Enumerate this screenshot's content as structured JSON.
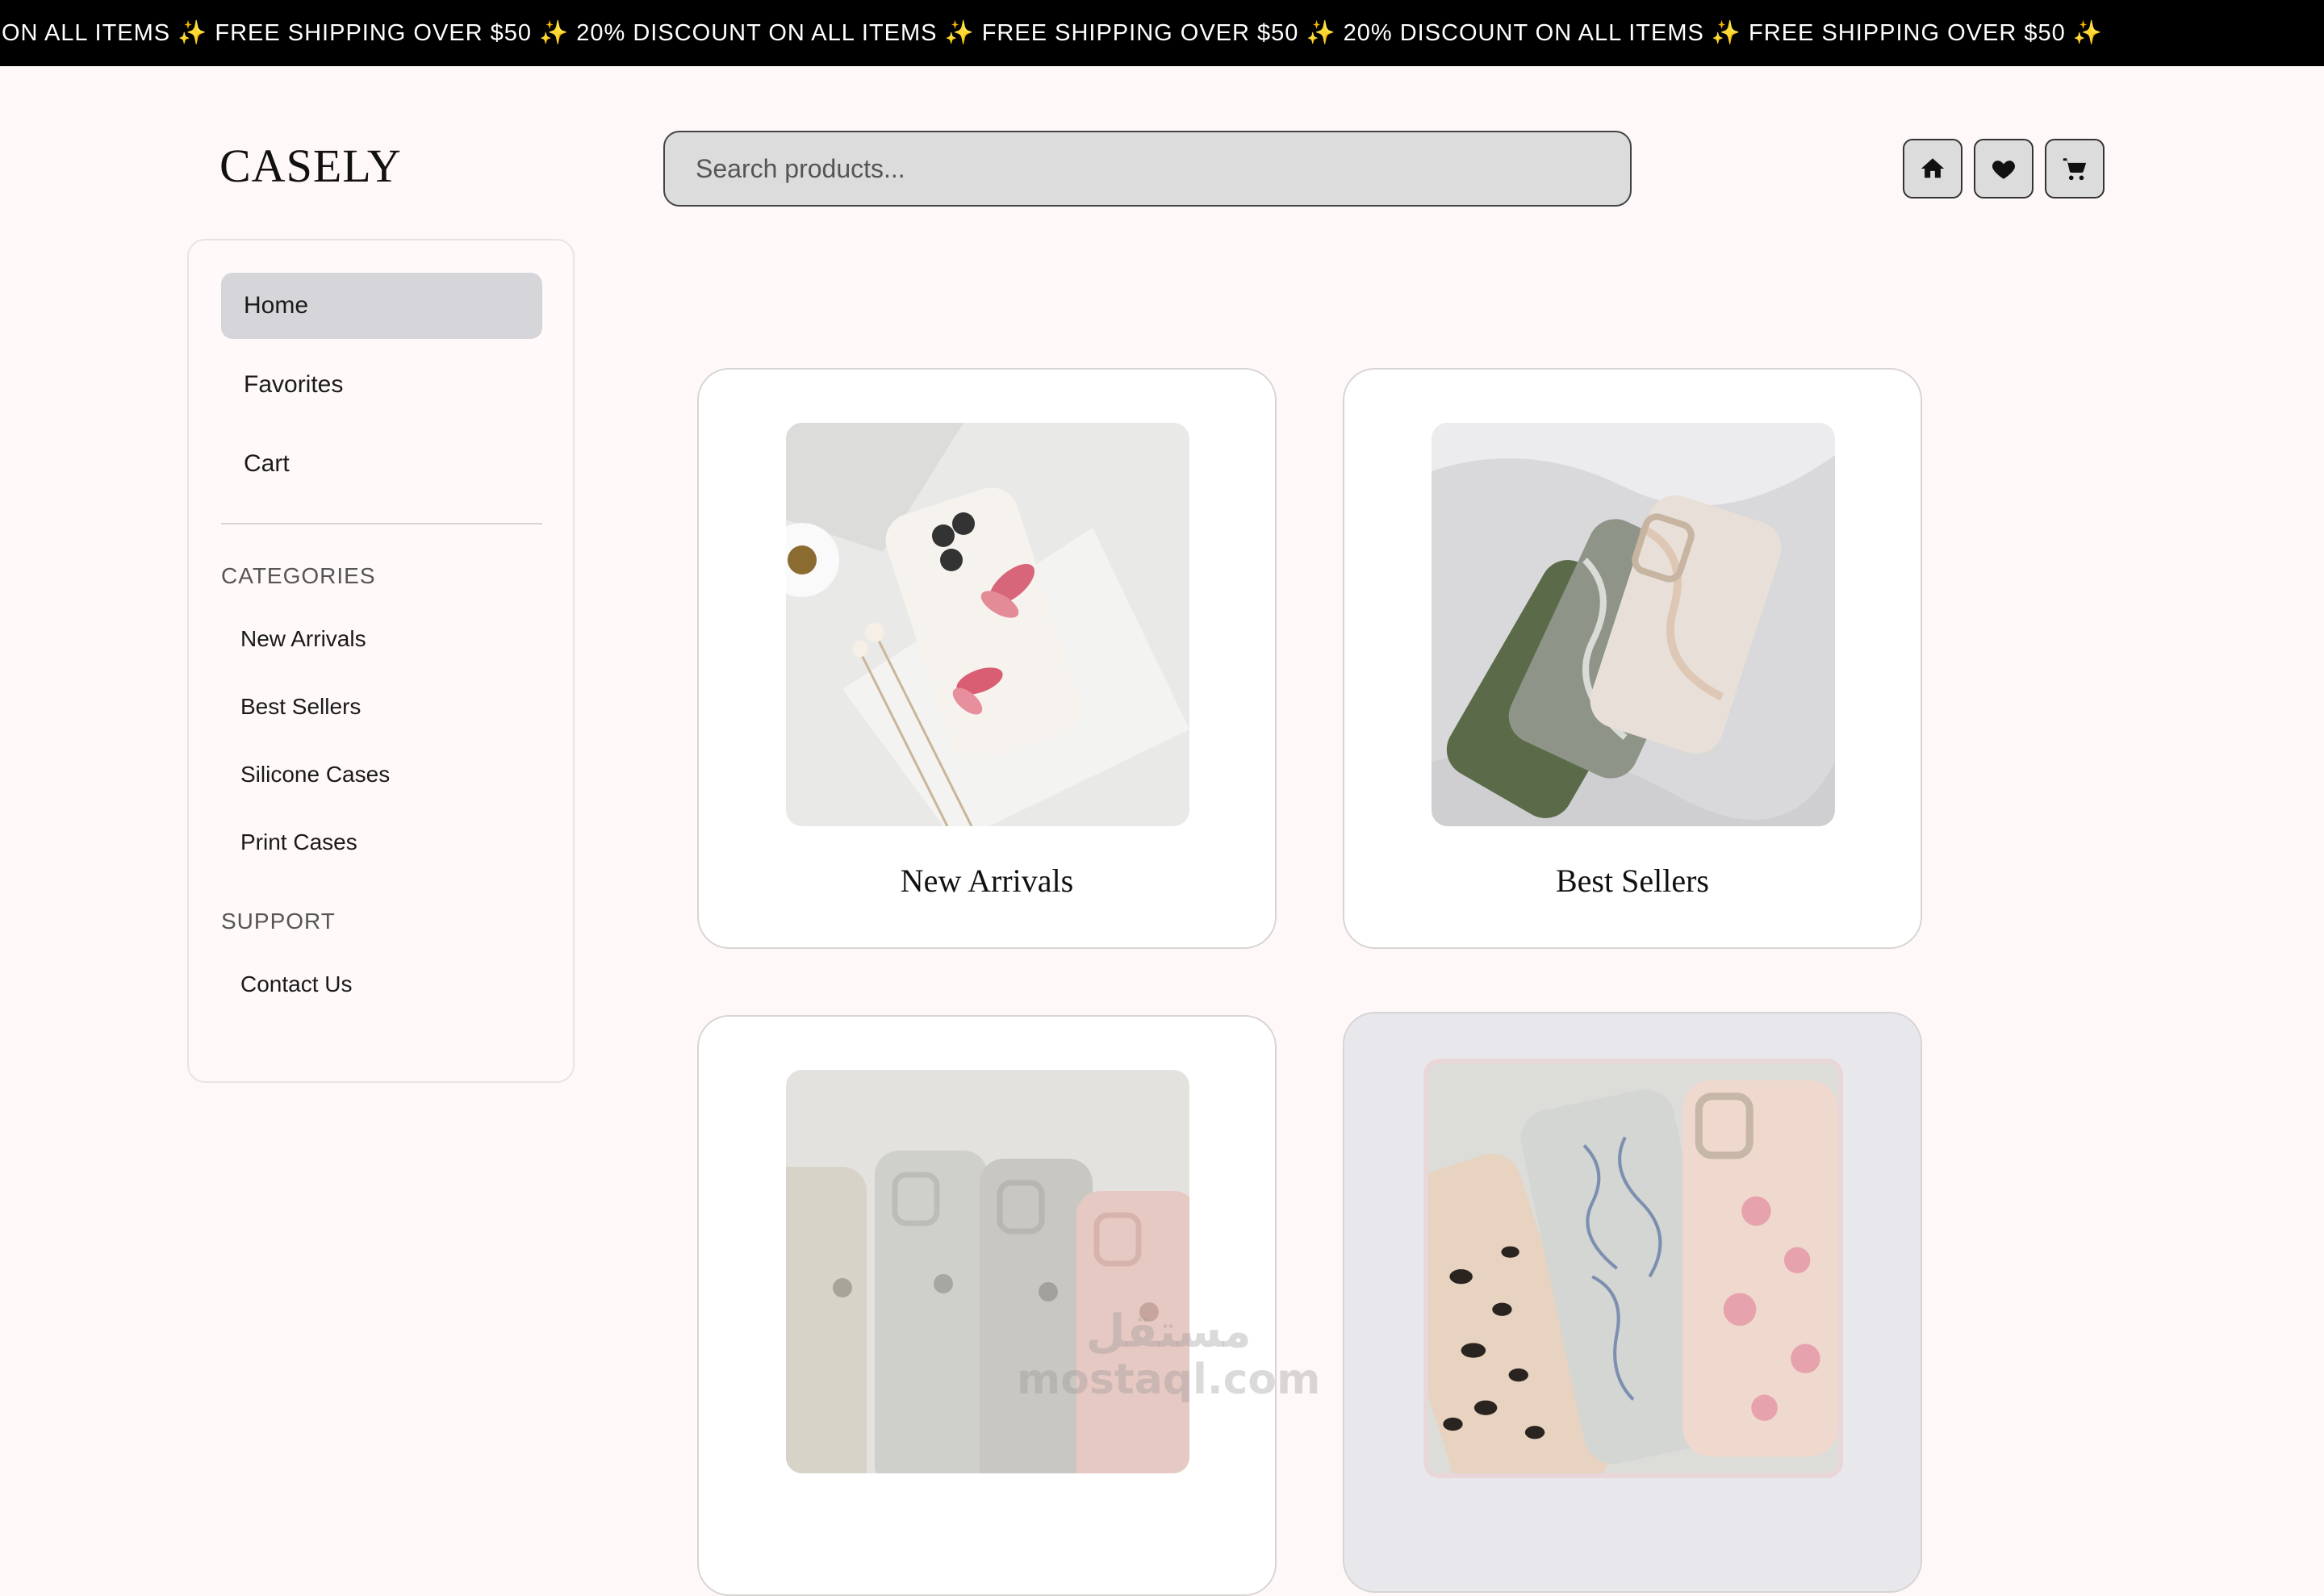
{
  "banner": {
    "text": "ON ALL ITEMS ✨ FREE SHIPPING OVER $50 ✨ 20% DISCOUNT ON ALL ITEMS ✨ FREE SHIPPING OVER $50 ✨ 20% DISCOUNT ON ALL ITEMS ✨ FREE SHIPPING OVER $50 ✨"
  },
  "header": {
    "logo": "CASELY",
    "search_placeholder": "Search products...",
    "buttons": [
      "home-icon",
      "heart-icon",
      "cart-icon"
    ]
  },
  "sidebar": {
    "nav": [
      {
        "label": "Home",
        "active": true
      },
      {
        "label": "Favorites",
        "active": false
      },
      {
        "label": "Cart",
        "active": false
      }
    ],
    "categories_title": "CATEGORIES",
    "categories": [
      "New Arrivals",
      "Best Sellers",
      "Silicone Cases",
      "Print Cases"
    ],
    "support_title": "SUPPORT",
    "support": [
      "Contact Us"
    ]
  },
  "cards": [
    {
      "title": "New Arrivals"
    },
    {
      "title": "Best Sellers"
    },
    {
      "title": ""
    },
    {
      "title": ""
    }
  ],
  "watermark": {
    "line1": "مستقل",
    "line2": "mostaql.com"
  },
  "colors": {
    "background": "#fff8f8",
    "banner": "#000000",
    "active_nav": "#d6d6da",
    "card_hover": "#e8e8ec"
  }
}
